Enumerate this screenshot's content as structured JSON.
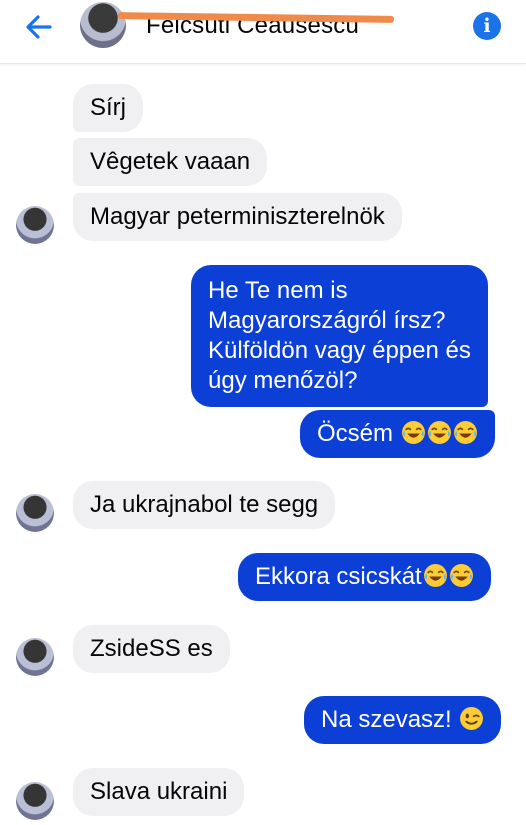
{
  "header": {
    "contact_name": "Felcsúti Ceausescu",
    "back_icon": "arrow-left-icon",
    "info_icon": "info-icon",
    "info_glyph": "i"
  },
  "messages": [
    {
      "dir": "in",
      "text": "Sírj"
    },
    {
      "dir": "in",
      "text": "Vêgetek vaaan"
    },
    {
      "dir": "in",
      "text": "Magyar peterminiszterelnök"
    },
    {
      "dir": "out",
      "lines": [
        "He Te nem is",
        "Magyarországról írsz?",
        "Külföldön vagy éppen és",
        "úgy menőzöl?"
      ]
    },
    {
      "dir": "out",
      "text": "Öcsém",
      "emoji": "tears-of-joy-emoji x3"
    },
    {
      "dir": "in",
      "text": "Ja ukrajnabol te segg"
    },
    {
      "dir": "out",
      "text": "Ekkora csicskát",
      "emoji": "tears-of-joy-emoji x2"
    },
    {
      "dir": "in",
      "text": "ZsideSS es"
    },
    {
      "dir": "out",
      "text": "Na szevasz!",
      "emoji": "winking-face-emoji"
    },
    {
      "dir": "in",
      "text": "Slava ukraini"
    }
  ],
  "colors": {
    "outgoing_bubble": "#0b3fd6",
    "incoming_bubble": "#f0f0f2",
    "accent": "#1a73e8",
    "redaction": "#f08a4b"
  }
}
